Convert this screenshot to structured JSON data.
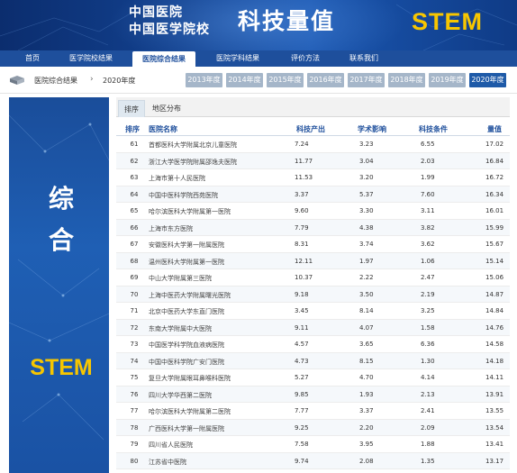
{
  "banner": {
    "org_line1": "中国医院",
    "org_line2": "中国医学院校",
    "title": "科技量值",
    "stem": "STEM"
  },
  "nav": {
    "items": [
      {
        "label": "首页",
        "active": false
      },
      {
        "label": "医学院校结果",
        "active": false
      },
      {
        "label": "医院综合结果",
        "active": true
      },
      {
        "label": "医院学科结果",
        "active": false
      },
      {
        "label": "评价方法",
        "active": false
      },
      {
        "label": "联系我们",
        "active": false
      }
    ]
  },
  "breadcrumb": {
    "label": "医院综合结果",
    "separator": "›",
    "current_year": "2020年度"
  },
  "years": [
    {
      "label": "2013年度",
      "active": false
    },
    {
      "label": "2014年度",
      "active": false
    },
    {
      "label": "2015年度",
      "active": false
    },
    {
      "label": "2016年度",
      "active": false
    },
    {
      "label": "2017年度",
      "active": false
    },
    {
      "label": "2018年度",
      "active": false
    },
    {
      "label": "2019年度",
      "active": false
    },
    {
      "label": "2020年度",
      "active": true
    }
  ],
  "promo": {
    "text_line1": "综",
    "text_line2": "合",
    "stem": "STEM"
  },
  "tabs": [
    {
      "label": "排序",
      "active": true
    },
    {
      "label": "地区分布",
      "active": false
    }
  ],
  "table": {
    "headers": {
      "rank": "排序",
      "name": "医院名称",
      "output": "科技产出",
      "influence": "学术影响",
      "condition": "科技条件",
      "value": "量值"
    },
    "rows": [
      {
        "rank": "61",
        "name": "首都医科大学附属北京儿童医院",
        "output": "7.24",
        "influence": "3.23",
        "condition": "6.55",
        "value": "17.02"
      },
      {
        "rank": "62",
        "name": "浙江大学医学院附属邵逸夫医院",
        "output": "11.77",
        "influence": "3.04",
        "condition": "2.03",
        "value": "16.84"
      },
      {
        "rank": "63",
        "name": "上海市第十人民医院",
        "output": "11.53",
        "influence": "3.20",
        "condition": "1.99",
        "value": "16.72"
      },
      {
        "rank": "64",
        "name": "中国中医科学院西苑医院",
        "output": "3.37",
        "influence": "5.37",
        "condition": "7.60",
        "value": "16.34"
      },
      {
        "rank": "65",
        "name": "哈尔滨医科大学附属第一医院",
        "output": "9.60",
        "influence": "3.30",
        "condition": "3.11",
        "value": "16.01"
      },
      {
        "rank": "66",
        "name": "上海市东方医院",
        "output": "7.79",
        "influence": "4.38",
        "condition": "3.82",
        "value": "15.99"
      },
      {
        "rank": "67",
        "name": "安徽医科大学第一附属医院",
        "output": "8.31",
        "influence": "3.74",
        "condition": "3.62",
        "value": "15.67"
      },
      {
        "rank": "68",
        "name": "温州医科大学附属第一医院",
        "output": "12.11",
        "influence": "1.97",
        "condition": "1.06",
        "value": "15.14"
      },
      {
        "rank": "69",
        "name": "中山大学附属第三医院",
        "output": "10.37",
        "influence": "2.22",
        "condition": "2.47",
        "value": "15.06"
      },
      {
        "rank": "70",
        "name": "上海中医药大学附属曙光医院",
        "output": "9.18",
        "influence": "3.50",
        "condition": "2.19",
        "value": "14.87"
      },
      {
        "rank": "71",
        "name": "北京中医药大学东直门医院",
        "output": "3.45",
        "influence": "8.14",
        "condition": "3.25",
        "value": "14.84"
      },
      {
        "rank": "72",
        "name": "东南大学附属中大医院",
        "output": "9.11",
        "influence": "4.07",
        "condition": "1.58",
        "value": "14.76"
      },
      {
        "rank": "73",
        "name": "中国医学科学院血液病医院",
        "output": "4.57",
        "influence": "3.65",
        "condition": "6.36",
        "value": "14.58"
      },
      {
        "rank": "74",
        "name": "中国中医科学院广安门医院",
        "output": "4.73",
        "influence": "8.15",
        "condition": "1.30",
        "value": "14.18"
      },
      {
        "rank": "75",
        "name": "复旦大学附属眼耳鼻喉科医院",
        "output": "5.27",
        "influence": "4.70",
        "condition": "4.14",
        "value": "14.11"
      },
      {
        "rank": "76",
        "name": "四川大学华西第二医院",
        "output": "9.85",
        "influence": "1.93",
        "condition": "2.13",
        "value": "13.91"
      },
      {
        "rank": "77",
        "name": "哈尔滨医科大学附属第二医院",
        "output": "7.77",
        "influence": "3.37",
        "condition": "2.41",
        "value": "13.55"
      },
      {
        "rank": "78",
        "name": "广西医科大学第一附属医院",
        "output": "9.25",
        "influence": "2.20",
        "condition": "2.09",
        "value": "13.54"
      },
      {
        "rank": "79",
        "name": "四川省人民医院",
        "output": "7.58",
        "influence": "3.95",
        "condition": "1.88",
        "value": "13.41"
      },
      {
        "rank": "80",
        "name": "江苏省中医院",
        "output": "9.74",
        "influence": "2.08",
        "condition": "1.35",
        "value": "13.17"
      }
    ]
  },
  "colors": {
    "navy": "#1e4f9c",
    "stem_yellow": "#f7c600",
    "year_inactive": "#a5b6c9",
    "year_active": "#1e5aa8"
  }
}
